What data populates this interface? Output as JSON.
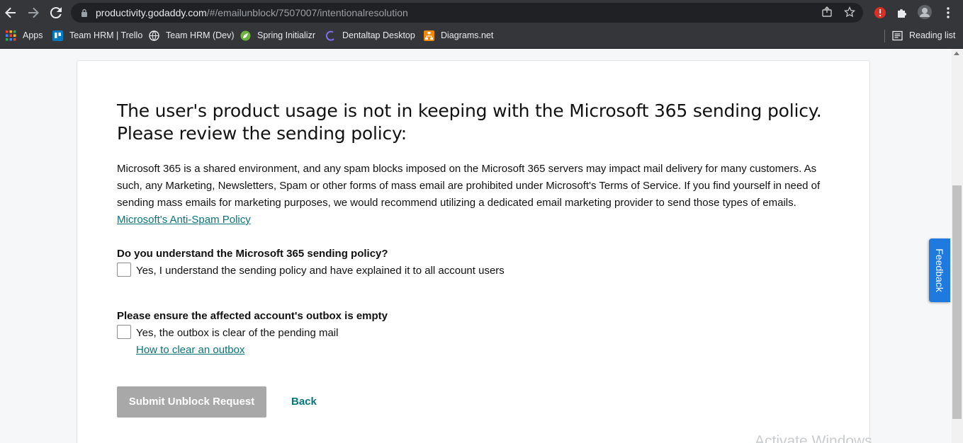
{
  "browser": {
    "url_host": "productivity.godaddy.com",
    "url_path": "/#/emailunblock/7507007/intentionalresolution",
    "bookmarks": [
      {
        "label": "Apps",
        "icon": "apps-grid-icon",
        "color": "#ea4335"
      },
      {
        "label": "Team HRM | Trello",
        "icon": "trello-icon",
        "color": "#0079bf"
      },
      {
        "label": "Team HRM (Dev)",
        "icon": "globe-icon",
        "color": "#e8eaed"
      },
      {
        "label": "Spring Initializr",
        "icon": "spring-leaf-icon",
        "color": "#6db33f"
      },
      {
        "label": "Dentaltap Desktop",
        "icon": "dentaltap-icon",
        "color": "#5b4fd6"
      },
      {
        "label": "Diagrams.net",
        "icon": "diagrams-icon",
        "color": "#f08705"
      }
    ],
    "reading_list": "Reading list"
  },
  "page": {
    "heading": "The user's product usage is not in keeping with the Microsoft 365 sending policy. Please review the sending policy:",
    "paragraph": "Microsoft 365 is a shared environment, and any spam blocks imposed on the Microsoft 365 servers may impact mail delivery for many customers. As such, any Marketing, Newsletters, Spam or other forms of mass email are prohibited under Microsoft's Terms of Service. If you find yourself in need of sending mass emails for marketing purposes, we would recommend utilizing a dedicated email marketing provider to send those types of emails.",
    "anti_spam_link": "Microsoft's Anti-Spam Policy",
    "question1": "Do you understand the Microsoft 365 sending policy?",
    "checkbox1": "Yes, I understand the sending policy and have explained it to all account users",
    "question2": "Please ensure the affected account's outbox is empty",
    "checkbox2": "Yes, the outbox is clear of the pending mail",
    "outbox_link": "How to clear an outbox",
    "submit": "Submit Unblock Request",
    "back": "Back",
    "watermark": "Activate Windows"
  },
  "feedback_tab": "Feedback",
  "colors": {
    "link": "#09757a",
    "submit_disabled": "#a8a8a8",
    "feedback": "#1f7ae0"
  }
}
